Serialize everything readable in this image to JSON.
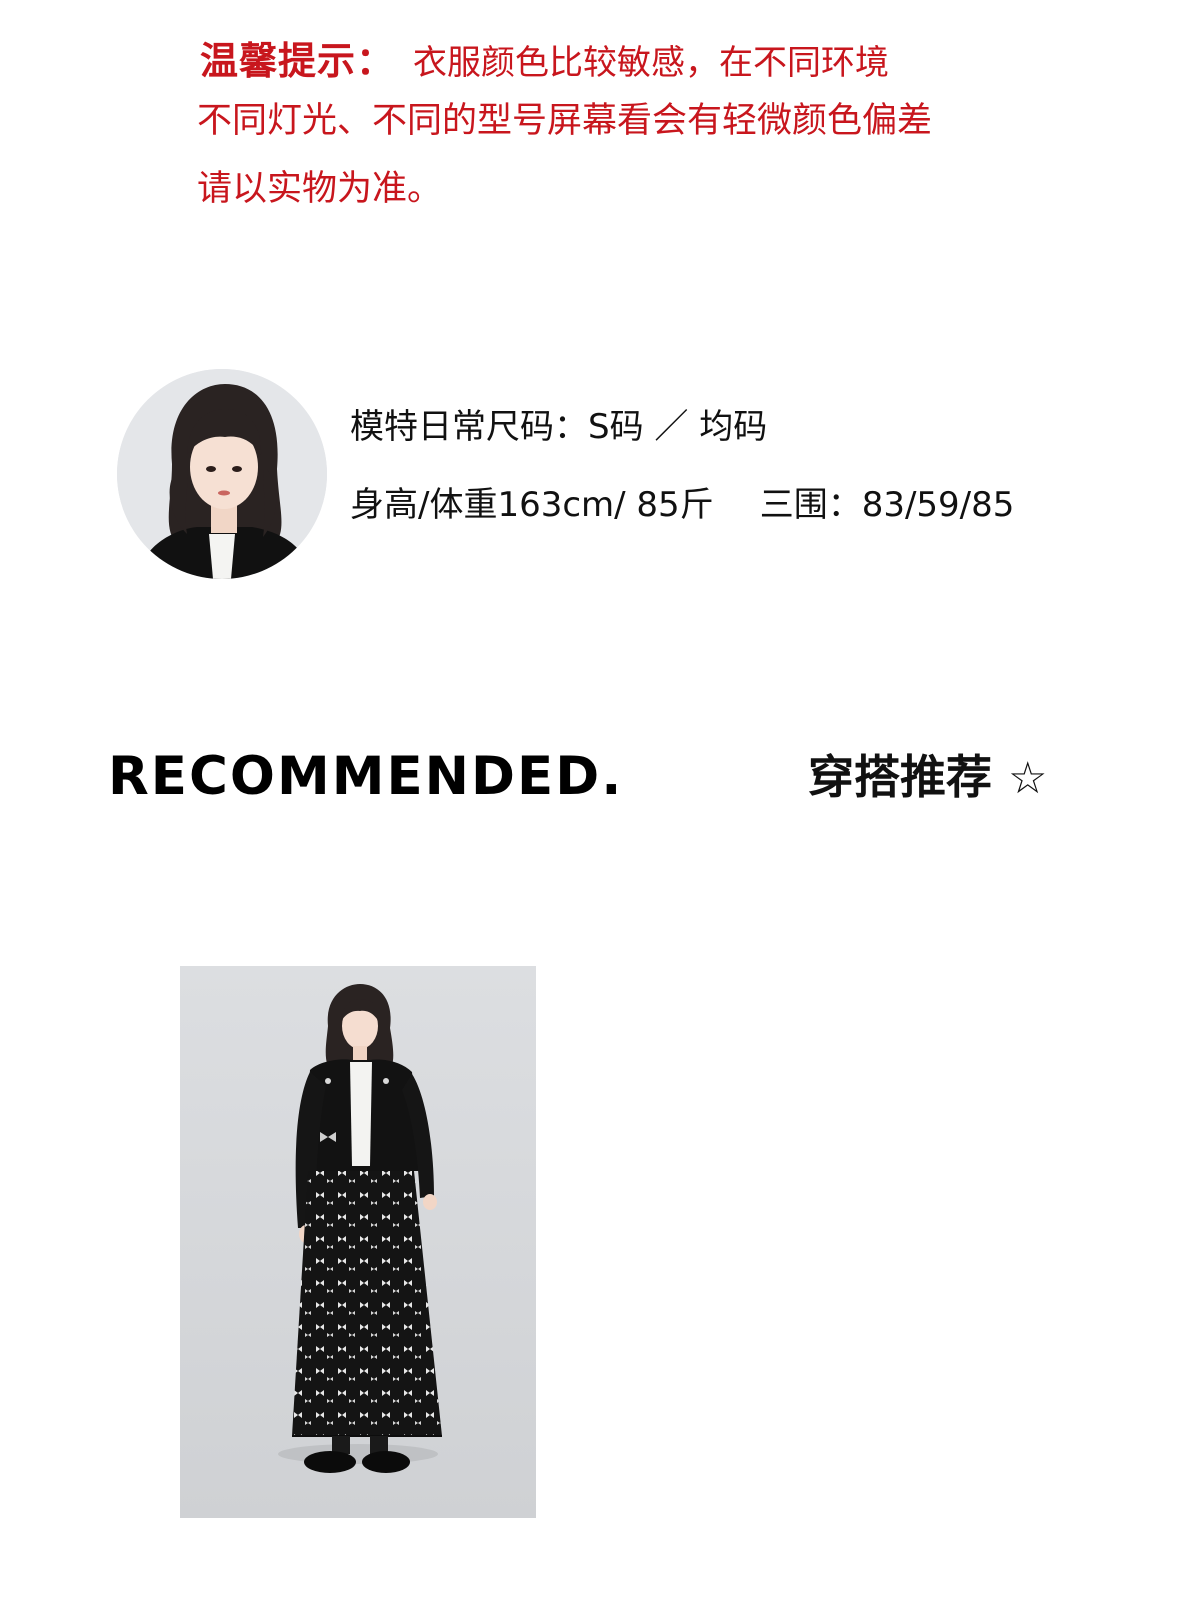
{
  "notice": {
    "title": "温馨提示：",
    "line1": "衣服颜色比较敏感，在不同环境",
    "line2": "不同灯光、不同的型号屏幕看会有轻微颜色偏差",
    "line3": "请以实物为准。",
    "color": "#c8161d"
  },
  "model": {
    "size_label": "模特日常尺码：S码 ／ 均码",
    "stats_label": "身高/体重163cm/ 85斤",
    "measurements": "三围：83/59/85",
    "avatar_icon": "model-portrait"
  },
  "recommend": {
    "heading_en": "RECOMMENDED.",
    "heading_cn": "穿搭推荐",
    "star": "☆"
  },
  "outfit": {
    "photo_icon": "outfit-photo"
  }
}
